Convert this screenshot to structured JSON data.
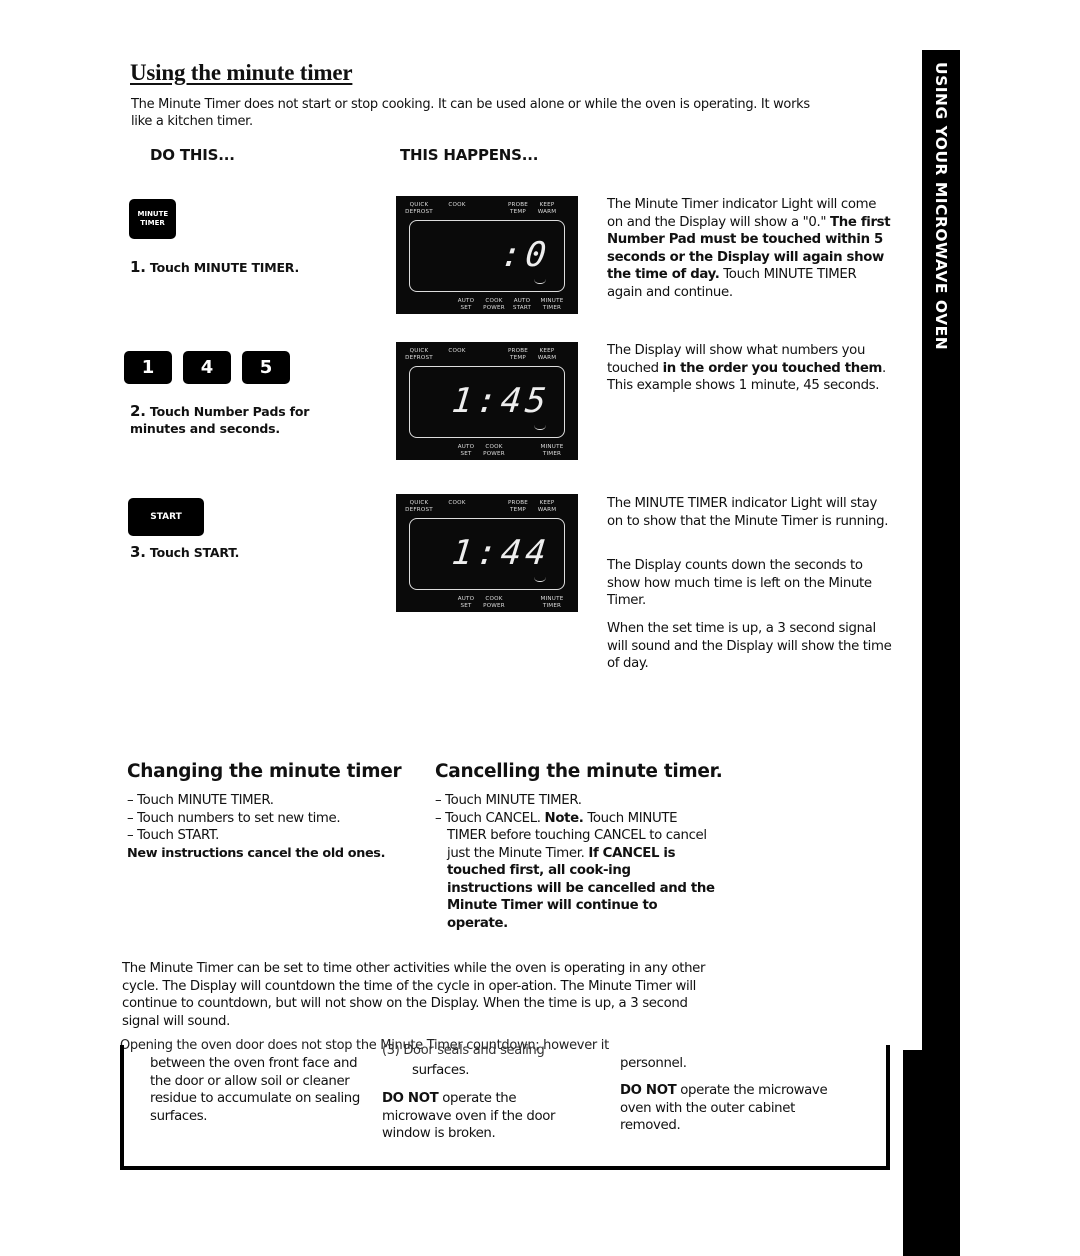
{
  "page": {
    "title": "Using the minute timer",
    "intro": "The Minute Timer does not start or stop cooking. It can be used alone or while the oven is operating. It works like a kitchen timer.",
    "col_do": "DO THIS...",
    "col_happens": "THIS HAPPENS...",
    "side_tab": "USING YOUR MICROWAVE OVEN"
  },
  "steps": [
    {
      "keys": [
        "MINUTE TIMER"
      ],
      "number": "1.",
      "instruction": "Touch MINUTE TIMER.",
      "display": {
        "readout": ":0",
        "labels_top": [
          "QUICK DEFROST",
          "COOK",
          "PROBE TEMP",
          "KEEP WARM"
        ],
        "labels_bottom": [
          "AUTO SET",
          "COOK POWER",
          "AUTO START",
          "MINUTE TIMER"
        ]
      },
      "result": [
        {
          "text": "The Minute Timer indicator Light will come on and the Display will show a \"0.\" ",
          "bold": false
        },
        {
          "text": "The first Number Pad must be touched within 5 seconds or the Display will again show the time of day.",
          "bold": true
        },
        {
          "text": " Touch MINUTE TIMER again and continue.",
          "bold": false
        }
      ]
    },
    {
      "keys": [
        "1",
        "4",
        "5"
      ],
      "number": "2.",
      "instruction": "Touch Number Pads for minutes and seconds.",
      "display": {
        "readout": "1:45",
        "labels_top": [
          "QUICK DEFROST",
          "COOK",
          "PROBE TEMP",
          "KEEP WARM"
        ],
        "labels_bottom": [
          "AUTO SET",
          "COOK POWER",
          "",
          "MINUTE TIMER"
        ]
      },
      "result": [
        {
          "text": "The Display will show what numbers you touched ",
          "bold": false
        },
        {
          "text": "in the order you touched them",
          "bold": true
        },
        {
          "text": ". This example shows 1 minute, 45 seconds.",
          "bold": false
        }
      ]
    },
    {
      "keys": [
        "START"
      ],
      "number": "3.",
      "instruction": "Touch START.",
      "display": {
        "readout": "1:44",
        "labels_top": [
          "QUICK DEFROST",
          "COOK",
          "PROBE TEMP",
          "KEEP WARM"
        ],
        "labels_bottom": [
          "AUTO SET",
          "COOK POWER",
          "",
          "MINUTE TIMER"
        ]
      },
      "result_paragraphs": [
        "The MINUTE TIMER indicator Light will stay on to show that the Minute Timer is running.",
        "The Display counts down the seconds to show how much time is left on the Minute Timer.",
        "When the set time is up, a 3 second signal will sound and the Display will show the time of day."
      ]
    }
  ],
  "changing": {
    "heading": "Changing the minute timer",
    "items": [
      "– Touch MINUTE TIMER.",
      "– Touch numbers to set new time.",
      "– Touch START."
    ],
    "note": "New instructions cancel the old ones."
  },
  "cancelling": {
    "heading": "Cancelling the minute timer.",
    "item1": "– Touch MINUTE TIMER.",
    "item2_prefix": "– Touch CANCEL. ",
    "item2_note_label": "Note.",
    "item2_text": " Touch MINUTE TIMER before touching CANCEL to cancel just the Minute Timer. ",
    "item2_bold": "If CANCEL is touched first, all cook-ing instructions will be cancelled and the Minute Timer will continue to operate."
  },
  "footer": {
    "paragraph": "The Minute Timer can be set to time other activities while the oven is operating in any other cycle. The Display will countdown the time of the cycle in oper-ation. The Minute Timer will continue to countdown, but will not show on the Display. When the time is up, a 3 second signal will sound.",
    "overlap_line": "Opening the oven door does not stop the Minute Timer countdown; however it",
    "overlap_item": "(3) Door seals and sealing",
    "bleed_col1": "between the oven front face and the door or allow soil or cleaner residue to accumulate on sealing surfaces.",
    "bleed_col2_top": "surfaces.",
    "bleed_col2_bold": "DO NOT",
    "bleed_col2_text": " operate the microwave oven if the door window is broken.",
    "bleed_col3_top": "personnel.",
    "bleed_col3_bold": "DO NOT",
    "bleed_col3_text": " operate the microwave oven with the outer cabinet removed."
  }
}
